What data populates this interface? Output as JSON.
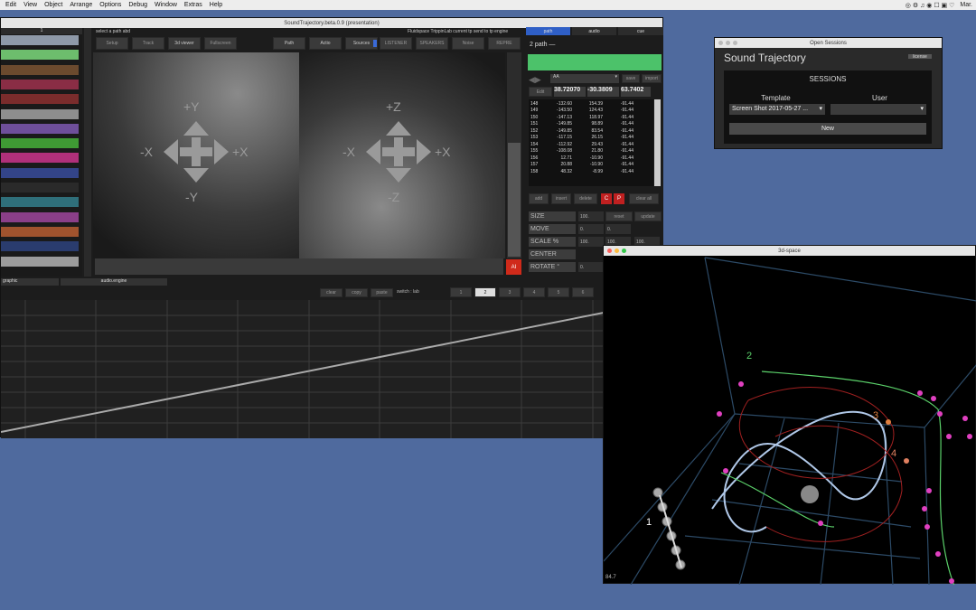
{
  "menubar": {
    "items": [
      "Edit",
      "View",
      "Object",
      "Arrange",
      "Options",
      "Debug",
      "Window",
      "Extras",
      "Help"
    ],
    "clock": "Mar."
  },
  "main_window": {
    "title": "SoundTrajectory.beta.0.9 (presentation)",
    "tracks_header": "1",
    "swatch_colors": [
      "#8e99a8",
      "#6dbd6d",
      "#6b4a2e",
      "#8a2d45",
      "#7a2c2c",
      "#8e8e8e",
      "#6e4f9a",
      "#3f9a34",
      "#b0307a",
      "#334488",
      "#2a2a2a",
      "#2f6f7a",
      "#8a3f88",
      "#a0532e",
      "#2a3c6e",
      "#9c9c9c"
    ],
    "select_path": "select a path abd",
    "status": "Fluidspace TrippinLab current tp send to tp engine",
    "toolbar": [
      "Setup",
      "Track",
      "3d viewer",
      "Fullscreen",
      "Path",
      "Actio",
      "Sources",
      "LISTENER",
      "SPEAKERS",
      "Noise",
      "REPRE"
    ],
    "xy": {
      "plus_y": "+Y",
      "minus_y": "-Y",
      "minus_x": "-X",
      "plus_x": "+X"
    },
    "xz": {
      "plus_z": "+Z",
      "minus_z": "-Z",
      "minus_x": "-X",
      "plus_x": "+X"
    },
    "ai_button": "AI",
    "bottom_tabs": [
      "graphic",
      "audio.engine"
    ],
    "graph_buttons": [
      "clear",
      "copy",
      "paste"
    ],
    "switch_label": "switch : lab",
    "page_buttons": [
      "1",
      "2",
      "3",
      "4",
      "5",
      "6"
    ],
    "active_page": "2"
  },
  "path_panel": {
    "tabs": [
      "path",
      "audio",
      "cue"
    ],
    "path_label": "2 path —",
    "path_color": "#4cc26a",
    "dropdown": "AA",
    "save": "save",
    "import": "import",
    "edit": "Edit",
    "coords": [
      "38.72070",
      "-30.3809",
      "63.7402"
    ],
    "rows": [
      [
        "148",
        "-132.60",
        "154.39",
        "-91.44"
      ],
      [
        "149",
        "-143.50",
        "124.43",
        "-91.44"
      ],
      [
        "150",
        "-147.13",
        "118.97",
        "-91.44"
      ],
      [
        "151",
        "-149.85",
        "98.89",
        "-91.44"
      ],
      [
        "152",
        "-149.85",
        "83.54",
        "-91.44"
      ],
      [
        "153",
        "-117.15",
        "26.15",
        "-91.44"
      ],
      [
        "154",
        "-112.92",
        "29.43",
        "-91.44"
      ],
      [
        "155",
        "-108.08",
        "21.80",
        "-91.44"
      ],
      [
        "156",
        "12.71",
        "-10.90",
        "-91.44"
      ],
      [
        "157",
        "20.88",
        "-10.90",
        "-91.44"
      ],
      [
        "158",
        "48.32",
        "-8.99",
        "-91.44"
      ]
    ],
    "actions": [
      "add",
      "insert",
      "delete",
      "C",
      "P",
      "clear all"
    ],
    "controls": [
      {
        "label": "SIZE",
        "v1": "100.",
        "v2": "reset",
        "v3": "update"
      },
      {
        "label": "MOVE",
        "v1": "0.",
        "v2": "0.",
        "v3": ""
      },
      {
        "label": "SCALE %",
        "v1": "100.",
        "v2": "100.",
        "v3": "100."
      },
      {
        "label": "CENTER",
        "v1": "",
        "v2": "",
        "v3": ""
      },
      {
        "label": "ROTATE °",
        "v1": "0.",
        "v2": "",
        "v3": ""
      }
    ]
  },
  "sessions": {
    "title": "Open Sessions",
    "app": "Sound Trajectory",
    "license": "license",
    "heading": "SESSIONS",
    "template_label": "Template",
    "user_label": "User",
    "template_value": "Screen Shot 2017-05-27 ...",
    "user_value": "",
    "new_button": "New"
  },
  "space3d": {
    "title": "3d-space",
    "labels": [
      "1",
      "2",
      "3",
      "4"
    ],
    "zoom": "84.7"
  }
}
